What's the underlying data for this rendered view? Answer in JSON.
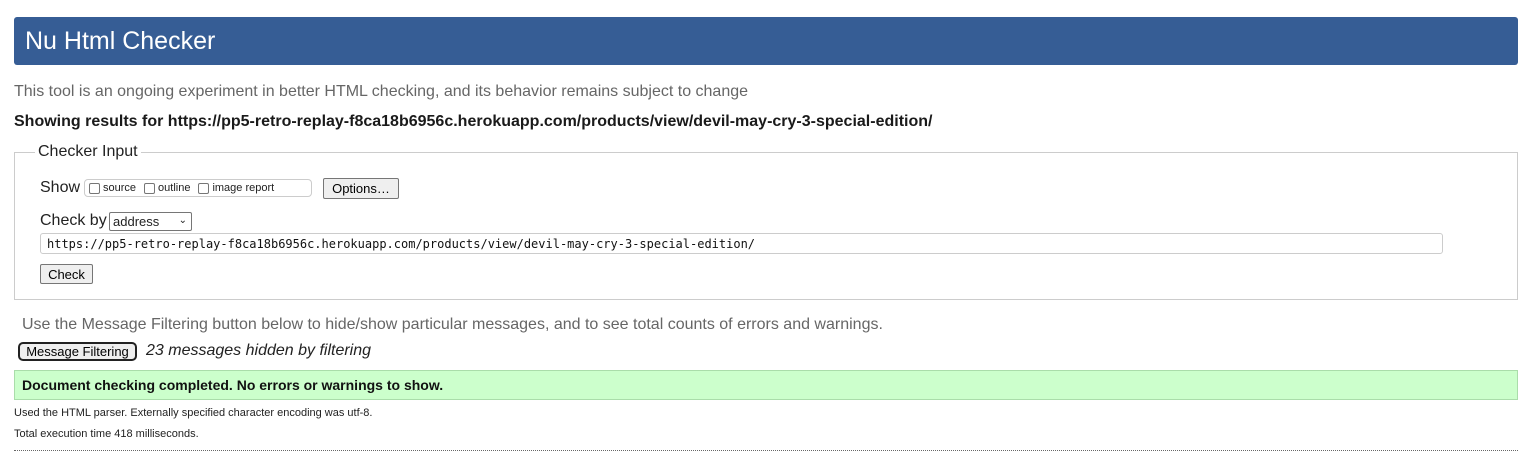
{
  "header": {
    "title": "Nu Html Checker"
  },
  "intro": "This tool is an ongoing experiment in better HTML checking, and its behavior remains subject to change",
  "showing": "Showing results for https://pp5-retro-replay-f8ca18b6956c.herokuapp.com/products/view/devil-may-cry-3-special-edition/",
  "checker_input": {
    "legend": "Checker Input",
    "show_label": "Show",
    "show_options": [
      {
        "label": "source",
        "checked": false
      },
      {
        "label": "outline",
        "checked": false
      },
      {
        "label": "image report",
        "checked": false
      }
    ],
    "options_button": "Options…",
    "check_by_label": "Check by",
    "check_by_value": "address",
    "url_value": "https://pp5-retro-replay-f8ca18b6956c.herokuapp.com/products/view/devil-may-cry-3-special-edition/",
    "check_button": "Check"
  },
  "filtering": {
    "note": "Use the Message Filtering button below to hide/show particular messages, and to see total counts of errors and warnings.",
    "button": "Message Filtering",
    "hidden_note": "23 messages hidden by filtering"
  },
  "result": {
    "success": "Document checking completed. No errors or warnings to show.",
    "parser_note": "Used the HTML parser. Externally specified character encoding was utf-8.",
    "exec_note": "Total execution time 418 milliseconds."
  },
  "colors": {
    "header_bg": "#365d95",
    "success_bg": "#ccffcc"
  }
}
